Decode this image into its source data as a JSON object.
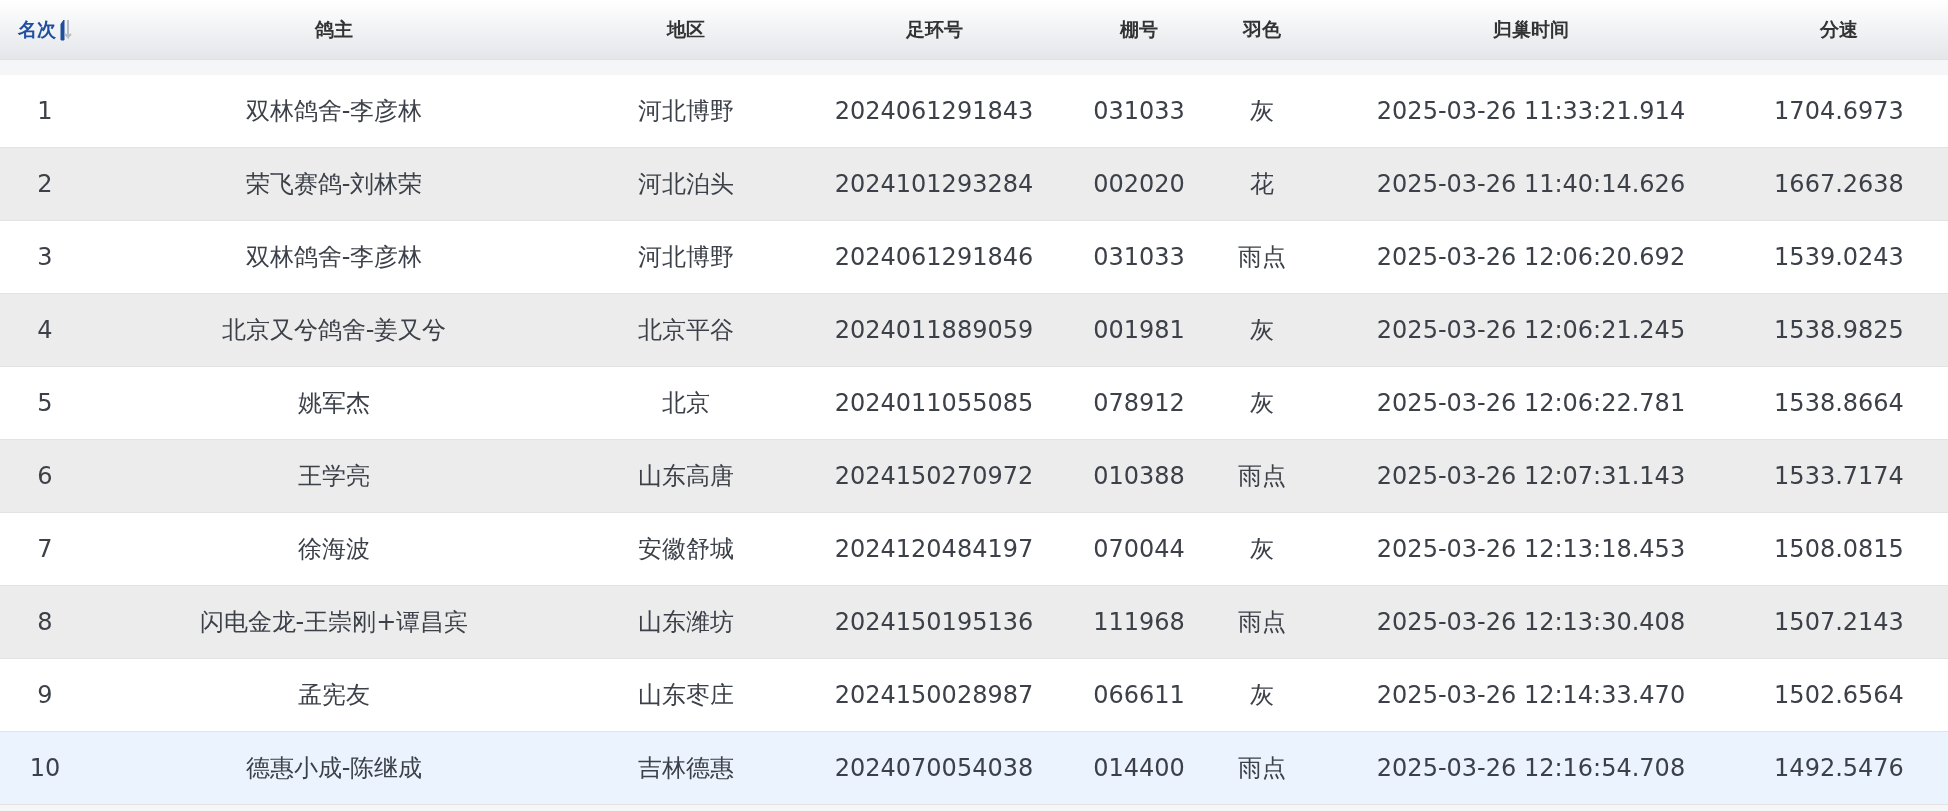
{
  "table": {
    "columns": [
      {
        "label": "名次",
        "sorted": true
      },
      {
        "label": "鸽主",
        "sorted": false
      },
      {
        "label": "地区",
        "sorted": false
      },
      {
        "label": "足环号",
        "sorted": false
      },
      {
        "label": "棚号",
        "sorted": false
      },
      {
        "label": "羽色",
        "sorted": false
      },
      {
        "label": "归巢时间",
        "sorted": false
      },
      {
        "label": "分速",
        "sorted": false
      }
    ],
    "rows": [
      {
        "selected": false,
        "cells": [
          "1",
          "双林鸽舍-李彦林",
          "河北博野",
          "2024061291843",
          "031033",
          "灰",
          "2025-03-26 11:33:21.914",
          "1704.6973"
        ]
      },
      {
        "selected": false,
        "cells": [
          "2",
          "荣飞赛鸽-刘林荣",
          "河北泊头",
          "2024101293284",
          "002020",
          "花",
          "2025-03-26 11:40:14.626",
          "1667.2638"
        ]
      },
      {
        "selected": false,
        "cells": [
          "3",
          "双林鸽舍-李彦林",
          "河北博野",
          "2024061291846",
          "031033",
          "雨点",
          "2025-03-26 12:06:20.692",
          "1539.0243"
        ]
      },
      {
        "selected": false,
        "cells": [
          "4",
          "北京又兮鸽舍-姜又兮",
          "北京平谷",
          "2024011889059",
          "001981",
          "灰",
          "2025-03-26 12:06:21.245",
          "1538.9825"
        ]
      },
      {
        "selected": false,
        "cells": [
          "5",
          "姚军杰",
          "北京",
          "2024011055085",
          "078912",
          "灰",
          "2025-03-26 12:06:22.781",
          "1538.8664"
        ]
      },
      {
        "selected": false,
        "cells": [
          "6",
          "王学亮",
          "山东高唐",
          "2024150270972",
          "010388",
          "雨点",
          "2025-03-26 12:07:31.143",
          "1533.7174"
        ]
      },
      {
        "selected": false,
        "cells": [
          "7",
          "徐海波",
          "安徽舒城",
          "2024120484197",
          "070044",
          "灰",
          "2025-03-26 12:13:18.453",
          "1508.0815"
        ]
      },
      {
        "selected": false,
        "cells": [
          "8",
          "闪电金龙-王崇刚+谭昌宾",
          "山东潍坊",
          "2024150195136",
          "111968",
          "雨点",
          "2025-03-26 12:13:30.408",
          "1507.2143"
        ]
      },
      {
        "selected": false,
        "cells": [
          "9",
          "孟宪友",
          "山东枣庄",
          "2024150028987",
          "066611",
          "灰",
          "2025-03-26 12:14:33.470",
          "1502.6564"
        ]
      },
      {
        "selected": true,
        "cells": [
          "10",
          "德惠小成-陈继成",
          "吉林德惠",
          "2024070054038",
          "014400",
          "雨点",
          "2025-03-26 12:16:54.708",
          "1492.5476"
        ]
      }
    ]
  }
}
